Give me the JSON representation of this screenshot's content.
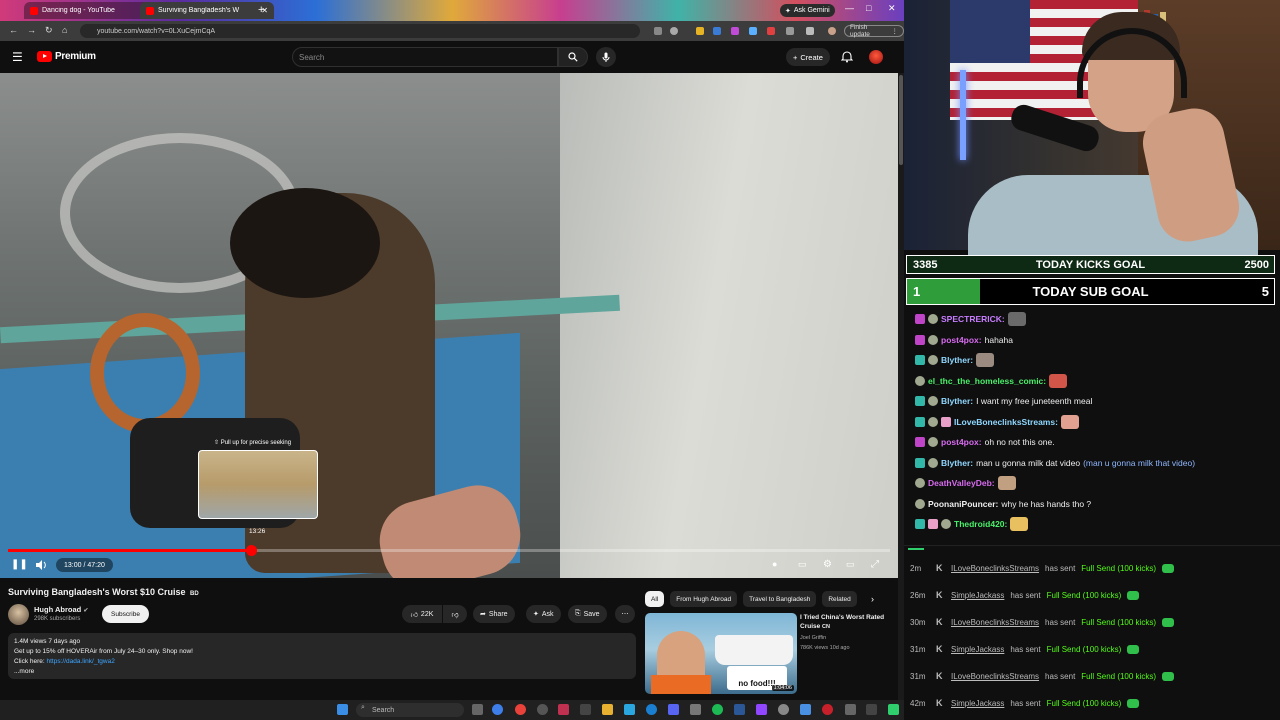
{
  "browser": {
    "tabs": [
      {
        "title": "Dancing dog - YouTube"
      },
      {
        "title": "Surviving Bangladesh's W"
      }
    ],
    "new_tab": "+",
    "ask_gemini": "Ask Gemini",
    "window_controls": {
      "minimize": "—",
      "maximize": "□",
      "close": "✕"
    },
    "url": "youtube.com/watch?v=0LXuCejmCqA",
    "finish_update": "Finish update"
  },
  "youtube": {
    "logo_text": "Premium",
    "search_placeholder": "Search",
    "create_label": "Create"
  },
  "player": {
    "seek_hint": "⇧ Pull up for precise seeking",
    "seek_preview_time": "13:26",
    "current_time": "13:00",
    "duration": "47:20",
    "time_display": "13:00 / 47:20",
    "progress_fraction": 0.275
  },
  "video_info": {
    "title": "Surviving Bangladesh's Worst $10 Cruise",
    "title_flag": "BD",
    "channel_name": "Hugh Abroad",
    "subscribers": "298K subscribers",
    "subscribe_label": "Subscribe",
    "likes": "22K",
    "share_label": "Share",
    "ask_label": "Ask",
    "save_label": "Save",
    "description": {
      "stats": "1.4M views  7 days ago",
      "line1": "Get up to 15% off HOVERAir from July 24–30 only. Shop now!",
      "line2_prefix": "Click here: ",
      "line2_link": "https://dada.link/_tgwa2",
      "more": "...more"
    }
  },
  "related": {
    "chips": [
      "All",
      "From Hugh Abroad",
      "Travel to Bangladesh",
      "Related"
    ],
    "items": [
      {
        "title": "I Tried China's Worst Rated Cruise",
        "title_flag": "CN",
        "channel": "Joel Griffin",
        "meta": "786K views  10d ago",
        "duration": "1:04:06",
        "thumb_text": "no food!!!"
      }
    ]
  },
  "taskbar": {
    "search_placeholder": "Search"
  },
  "stream": {
    "kicks_goal": {
      "current": "3385",
      "label": "TODAY KICKS GOAL",
      "target": "2500"
    },
    "sub_goal": {
      "current": "1",
      "label": "TODAY SUB GOAL",
      "target": "5",
      "progress_fraction": 0.2
    },
    "chat": [
      {
        "user": "SPECTRERICK:",
        "color": "#c77dff",
        "msg": "",
        "emote": "#6a6a6a"
      },
      {
        "user": "post4pox:",
        "color": "#d86bf0",
        "msg": "hahaha",
        "emote": ""
      },
      {
        "user": "Blyther:",
        "color": "#8fd8ff",
        "msg": "",
        "emote": "#9a8a80"
      },
      {
        "user": "el_thc_the_homeless_comic:",
        "color": "#4af06a",
        "msg": "",
        "emote": "#d2554a"
      },
      {
        "user": "Blyther:",
        "color": "#8fd8ff",
        "msg": "I want my free juneteenth meal",
        "emote": ""
      },
      {
        "user": "ILoveBoneclinksStreams:",
        "color": "#8fd8ff",
        "msg": "",
        "emote": "#e2a090"
      },
      {
        "user": "post4pox:",
        "color": "#d86bf0",
        "msg": "oh no not this one.",
        "emote": ""
      },
      {
        "user": "Blyther:",
        "color": "#8fd8ff",
        "msg": "man u gonna milk dat video",
        "quote": "(man u gonna milk that video)",
        "emote": ""
      },
      {
        "user": "DeathValleyDeb:",
        "color": "#d86bf0",
        "msg": "",
        "emote": "#c0a080"
      },
      {
        "user": "PoonaniPouncer:",
        "color": "#efeff1",
        "msg": "why he has hands tho ?",
        "emote": ""
      },
      {
        "user": "Thedroid420:",
        "color": "#4af06a",
        "msg": "",
        "emote": "#e8c060"
      }
    ],
    "events": [
      {
        "time": "2m",
        "user": "ILoveBoneclinksStreams",
        "text": "has sent",
        "gift": "Full Send (100 kicks)"
      },
      {
        "time": "26m",
        "user": "SimpleJackass",
        "text": "has sent",
        "gift": "Full Send (100 kicks)"
      },
      {
        "time": "30m",
        "user": "ILoveBoneclinksStreams",
        "text": "has sent",
        "gift": "Full Send (100 kicks)"
      },
      {
        "time": "31m",
        "user": "SimpleJackass",
        "text": "has sent",
        "gift": "Full Send (100 kicks)"
      },
      {
        "time": "31m",
        "user": "ILoveBoneclinksStreams",
        "text": "has sent",
        "gift": "Full Send (100 kicks)"
      },
      {
        "time": "42m",
        "user": "SimpleJackass",
        "text": "has sent",
        "gift": "Full Send (100 kicks)"
      }
    ]
  }
}
